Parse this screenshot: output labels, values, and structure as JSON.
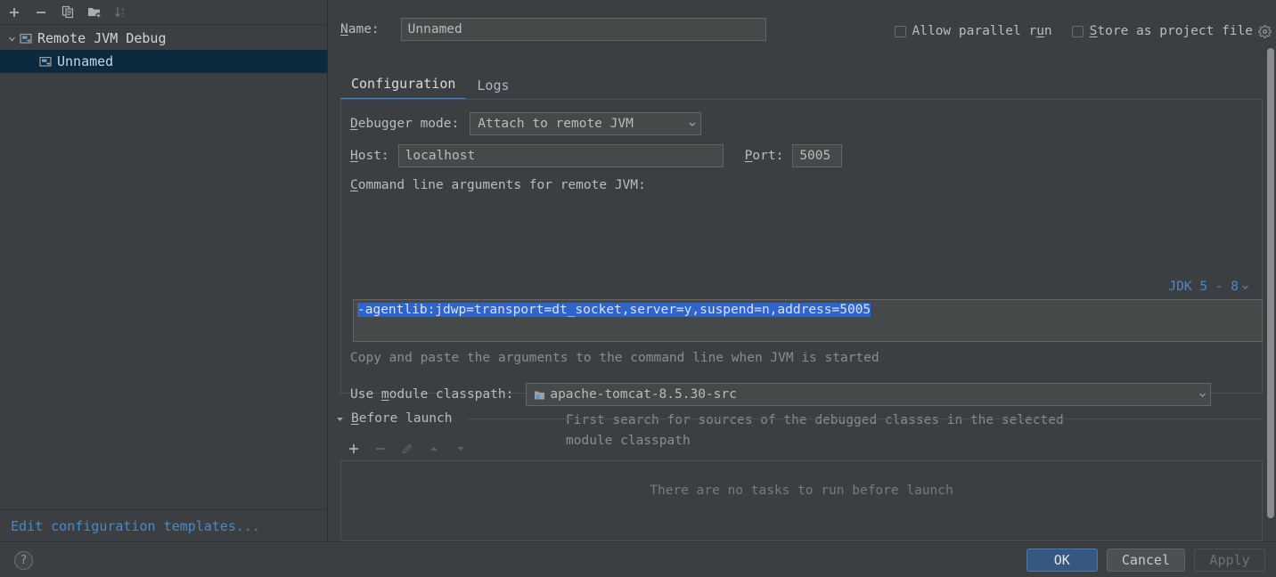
{
  "sidebar": {
    "toolbar": [
      {
        "name": "add-configuration-button",
        "icon": "plus-icon",
        "enabled": true
      },
      {
        "name": "remove-configuration-button",
        "icon": "minus-icon",
        "enabled": true
      },
      {
        "name": "copy-configuration-button",
        "icon": "copy-icon",
        "enabled": true
      },
      {
        "name": "save-configuration-button",
        "icon": "folder-add-icon",
        "enabled": true
      },
      {
        "name": "sort-configurations-button",
        "icon": "sort-alpha-icon",
        "enabled": false
      }
    ],
    "tree": {
      "root": {
        "label": "Remote JVM Debug",
        "icon": "remote-debug-icon",
        "expanded": true
      },
      "children": [
        {
          "label": "Unnamed",
          "icon": "remote-debug-icon",
          "selected": true
        }
      ]
    },
    "templates_link": "Edit configuration templates..."
  },
  "header": {
    "name_label": "Name:",
    "name_mnemonic": "N",
    "name_value": "Unnamed",
    "allow_parallel_run": {
      "label": "Allow parallel run",
      "checked": false,
      "mnemonic": "u"
    },
    "store_as_project_file": {
      "label": "Store as project file",
      "checked": false,
      "mnemonic": "S"
    },
    "gear_icon": "gear-icon"
  },
  "tabs": [
    {
      "label": "Configuration",
      "active": true
    },
    {
      "label": "Logs",
      "active": false
    }
  ],
  "configuration": {
    "debugger_mode": {
      "label": "Debugger mode:",
      "mnemonic": "D",
      "value": "Attach to remote JVM"
    },
    "host": {
      "label": "Host:",
      "mnemonic": "H",
      "value": "localhost"
    },
    "port": {
      "label": "Port:",
      "mnemonic": "P",
      "value": "5005"
    },
    "command_line": {
      "label": "Command line arguments for remote JVM:",
      "mnemonic": "C",
      "value": "-agentlib:jdwp=transport=dt_socket,server=y,suspend=n,address=5005",
      "selected": true,
      "jdk_selector": "JDK 5 - 8",
      "hint": "Copy and paste the arguments to the command line when JVM is started"
    },
    "module_classpath": {
      "label": "Use module classpath:",
      "mnemonic": "m",
      "value": "apache-tomcat-8.5.30-src",
      "icon": "module-icon",
      "hint_line1": "First search for sources of the debugged classes in the selected",
      "hint_line2": "module classpath"
    }
  },
  "before_launch": {
    "title": "Before launch",
    "mnemonic": "B",
    "expanded": true,
    "toolbar": [
      {
        "name": "add-task-button",
        "icon": "plus-icon",
        "enabled": true
      },
      {
        "name": "remove-task-button",
        "icon": "minus-icon",
        "enabled": false
      },
      {
        "name": "edit-task-button",
        "icon": "pencil-icon",
        "enabled": false
      },
      {
        "name": "move-task-up-button",
        "icon": "arrow-up-icon",
        "enabled": false
      },
      {
        "name": "move-task-down-button",
        "icon": "arrow-down-icon",
        "enabled": false
      }
    ],
    "empty_text": "There are no tasks to run before launch"
  },
  "footer": {
    "help_label": "?",
    "ok_label": "OK",
    "cancel_label": "Cancel",
    "apply_label": "Apply",
    "apply_enabled": false
  },
  "colors": {
    "background": "#3c3f41",
    "field_background": "#45494a",
    "accent_blue": "#4a88c7",
    "selection_blue": "#2f65ca",
    "tree_selection": "#0d293e",
    "default_button": "#365880",
    "text": "#bbbbbb",
    "hint_text": "#8c8c8c"
  }
}
